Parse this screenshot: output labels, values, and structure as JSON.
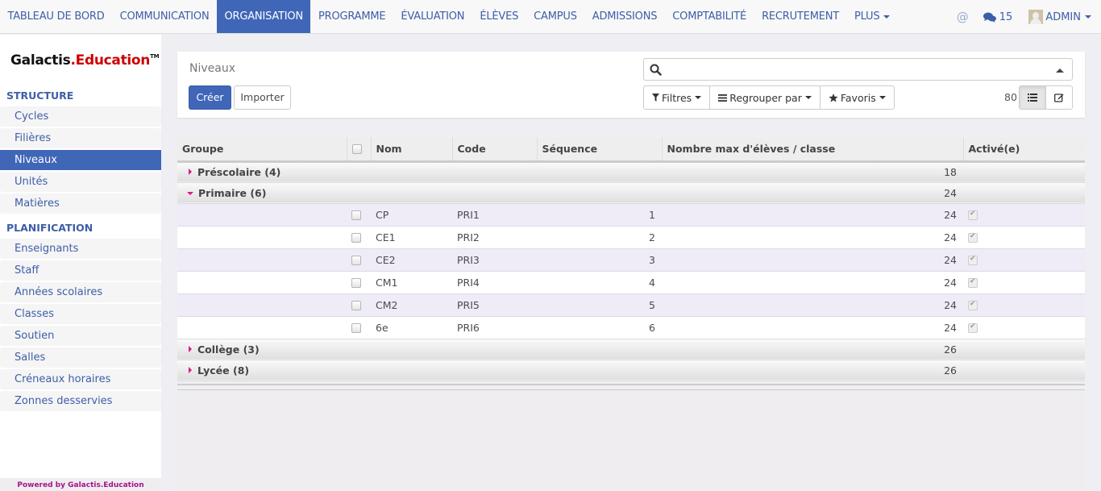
{
  "topnav": {
    "menu": [
      {
        "label": "TABLEAU DE BORD",
        "active": false
      },
      {
        "label": "COMMUNICATION",
        "active": false
      },
      {
        "label": "ORGANISATION",
        "active": true
      },
      {
        "label": "PROGRAMME",
        "active": false
      },
      {
        "label": "ÉVALUATION",
        "active": false
      },
      {
        "label": "ÉLÈVES",
        "active": false
      },
      {
        "label": "CAMPUS",
        "active": false
      },
      {
        "label": "ADMISSIONS",
        "active": false
      },
      {
        "label": "COMPTABILITÉ",
        "active": false
      },
      {
        "label": "RECRUTEMENT",
        "active": false
      }
    ],
    "more_label": "PLUS",
    "at_symbol": "@",
    "messages_count": "15",
    "user_label": "ADMIN"
  },
  "sidebar": {
    "logo": {
      "part1": "Galactis",
      "part2": ".Education",
      "tm": "TM"
    },
    "sections": [
      {
        "title": "STRUCTURE",
        "items": [
          {
            "label": "Cycles",
            "active": false
          },
          {
            "label": "Filières",
            "active": false
          },
          {
            "label": "Niveaux",
            "active": true
          },
          {
            "label": "Unités",
            "active": false
          },
          {
            "label": "Matières",
            "active": false
          }
        ]
      },
      {
        "title": "PLANIFICATION",
        "items": [
          {
            "label": "Enseignants",
            "active": false
          },
          {
            "label": "Staff",
            "active": false
          },
          {
            "label": "Années scolaires",
            "active": false
          },
          {
            "label": "Classes",
            "active": false
          },
          {
            "label": "Soutien",
            "active": false
          },
          {
            "label": "Salles",
            "active": false
          },
          {
            "label": "Créneaux horaires",
            "active": false
          },
          {
            "label": "Zonnes desservies",
            "active": false
          }
        ]
      }
    ],
    "powered_by": "Powered by Galactis.Education"
  },
  "control_panel": {
    "breadcrumb": "Niveaux",
    "create_label": "Créer",
    "import_label": "Importer",
    "search": {
      "value": "",
      "placeholder": ""
    },
    "filters_label": "Filtres",
    "groupby_label": "Regrouper par",
    "favorites_label": "Favoris",
    "pager_value": "80"
  },
  "table": {
    "columns": [
      "Groupe",
      "",
      "Nom",
      "Code",
      "Séquence",
      "Nombre max d'élèves / classe",
      "Activé(e)"
    ],
    "groups": [
      {
        "label": "Préscolaire (4)",
        "expanded": false,
        "max_students_total": "18",
        "rows": []
      },
      {
        "label": "Primaire (6)",
        "expanded": true,
        "max_students_total": "24",
        "rows": [
          {
            "name": "CP",
            "code": "PRI1",
            "sequence": "1",
            "max_students": "24",
            "active": true
          },
          {
            "name": "CE1",
            "code": "PRI2",
            "sequence": "2",
            "max_students": "24",
            "active": true
          },
          {
            "name": "CE2",
            "code": "PRI3",
            "sequence": "3",
            "max_students": "24",
            "active": true
          },
          {
            "name": "CM1",
            "code": "PRI4",
            "sequence": "4",
            "max_students": "24",
            "active": true
          },
          {
            "name": "CM2",
            "code": "PRI5",
            "sequence": "5",
            "max_students": "24",
            "active": true
          },
          {
            "name": "6e",
            "code": "PRI6",
            "sequence": "6",
            "max_students": "24",
            "active": true
          }
        ]
      },
      {
        "label": "Collège (3)",
        "expanded": false,
        "max_students_total": "26",
        "rows": []
      },
      {
        "label": "Lycée (8)",
        "expanded": false,
        "max_students_total": "26",
        "rows": []
      }
    ]
  }
}
